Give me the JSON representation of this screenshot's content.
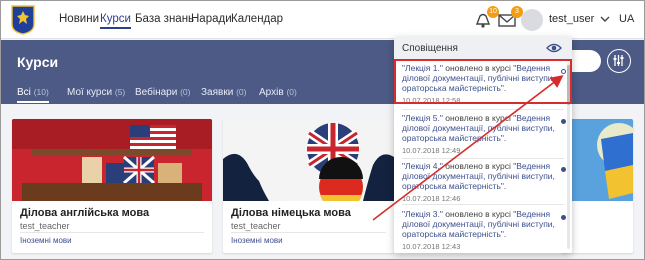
{
  "nav": {
    "items": [
      {
        "label": "Новини"
      },
      {
        "label": "Курси"
      },
      {
        "label": "База знань"
      },
      {
        "label": "Наради"
      },
      {
        "label": "Календар"
      }
    ],
    "active_index": 1,
    "badges": {
      "bell": "10",
      "mail": "3"
    },
    "user_name": "test_user",
    "language": "UA"
  },
  "page": {
    "title": "Курси",
    "tabs": [
      {
        "label": "Всі",
        "count": "(10)"
      },
      {
        "label": "Мої курси",
        "count": "(5)"
      },
      {
        "label": "Вебінари",
        "count": "(0)"
      },
      {
        "label": "Заявки",
        "count": "(0)"
      },
      {
        "label": "Архів",
        "count": "(0)"
      }
    ]
  },
  "courses": [
    {
      "title": "Ділова англійська мова",
      "author": "test_teacher",
      "category": "Іноземні мови"
    },
    {
      "title": "Ділова німецька мова",
      "author": "test_teacher",
      "category": "Іноземні мови"
    }
  ],
  "notifications": {
    "title": "Сповіщення",
    "items": [
      {
        "lecture": "\"Лекція 1.\"",
        "text": " оновлено в курсі ",
        "course": "\"Ведення ділової документації, публічні виступи, ораторська майстерність\"",
        "end": ".",
        "date": "10.07.2018 12:58",
        "read": true
      },
      {
        "lecture": "\"Лекція 5.\"",
        "text": " оновлено в курсі ",
        "course": "\"Ведення ділової документації, публічні виступи, ораторська майстерність\"",
        "end": ".",
        "date": "10.07.2018 12:49",
        "read": false
      },
      {
        "lecture": "\"Лекція 4.\"",
        "text": " оновлено в курсі ",
        "course": "\"Ведення ділової документації, публічні виступи, ораторська майстерність\"",
        "end": ".",
        "date": "10.07.2018 12:46",
        "read": false
      },
      {
        "lecture": "\"Лекція 3.\"",
        "text": " оновлено в курсі ",
        "course": "\"Ведення ділової документації, публічні виступи, ораторська майстерність\"",
        "end": ".",
        "date": "10.07.2018 12:43",
        "read": false
      }
    ]
  },
  "colors": {
    "accent": "#2b3f8f",
    "header_band": "#4c5a85",
    "highlight": "#d62c2c",
    "badge": "#f39c12"
  }
}
